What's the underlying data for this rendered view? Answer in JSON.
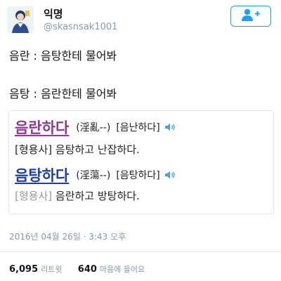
{
  "user": {
    "display_name": "익명",
    "handle": "@skasnsak1001"
  },
  "follow_button": {
    "icon": "add-user-icon",
    "color": "#1da1f2"
  },
  "tweet": {
    "line1": "음란 : 음탕한테 물어봐",
    "line2": "음탕 : 음란한테 물어봐"
  },
  "dictionary": {
    "entries": [
      {
        "word": "음란하다",
        "hanja": "(淫亂--)",
        "pronunciation": "[음난하다]",
        "pos": "[형용사]",
        "definition": "음탕하고 난잡하다.",
        "color": "#8b3a8e"
      },
      {
        "word": "음탕하다",
        "hanja": "(淫蕩--)",
        "pronunciation": "[음탕하다]",
        "pos": "[형용사]",
        "definition": "음란하고 방탕하다.",
        "color": "#1f3fa0"
      }
    ]
  },
  "meta": {
    "timestamp": "2016년 04월 26일 · 3:43 오후",
    "retweets": "6,095",
    "retweets_label": "리트윗",
    "likes": "640",
    "likes_label": "마음에 들어요"
  }
}
